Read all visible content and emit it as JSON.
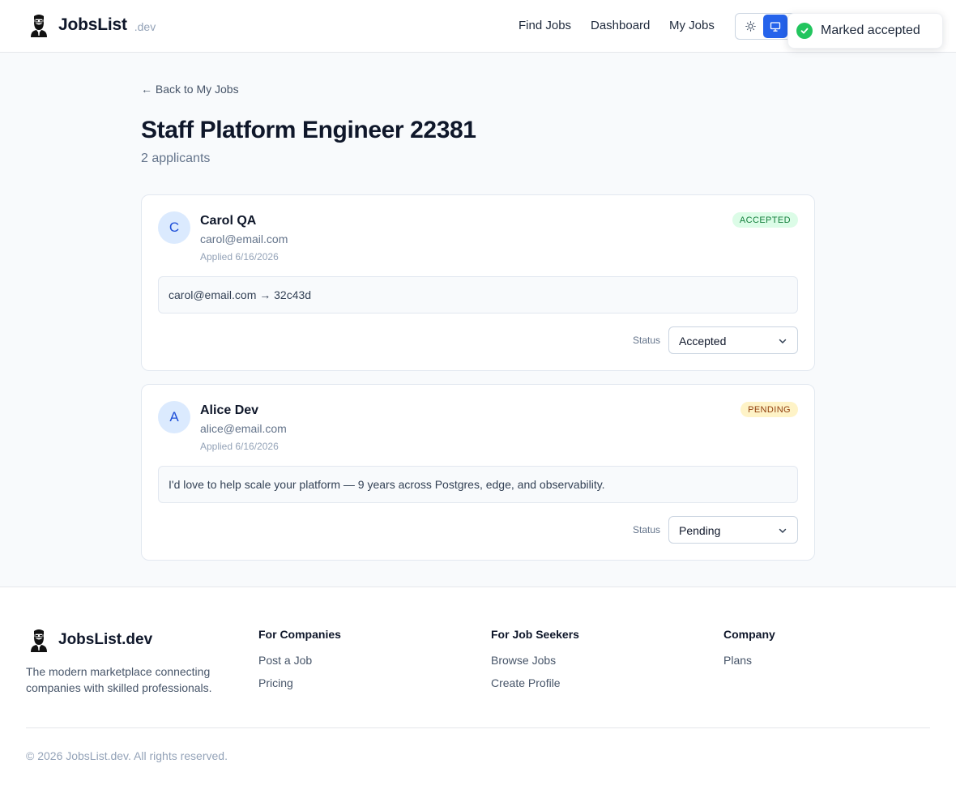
{
  "header": {
    "logo_text": "JobsList",
    "logo_suffix": ".dev",
    "logo_icon": "bearded-man-icon",
    "nav": [
      "Find Jobs",
      "Dashboard",
      "My Jobs"
    ],
    "theme_icons": [
      "sun-icon",
      "monitor-icon"
    ],
    "accent": "#2563eb"
  },
  "toast": {
    "text": "Marked accepted",
    "icon": "check-circle-icon",
    "color": "#22c55e"
  },
  "page": {
    "back_link": "← Back to My Jobs",
    "title": "Staff Platform Engineer 22381",
    "subtitle": "2 applicants"
  },
  "applicants": [
    {
      "initial": "C",
      "name": "Carol QA",
      "email": "carol@email.com",
      "applied": "Applied 6/16/2026",
      "badge": "ACCEPTED",
      "badge_color": "#15803d",
      "message": "carol@email.com → 32c43d",
      "status_label": "Status",
      "status_value": "Accepted"
    },
    {
      "initial": "A",
      "name": "Alice Dev",
      "email": "alice@email.com",
      "applied": "Applied 6/16/2026",
      "badge": "PENDING",
      "badge_color": "#92400e",
      "message": "I'd love to help scale your platform — 9 years across Postgres, edge, and observability.",
      "status_label": "Status",
      "status_value": "Pending"
    }
  ],
  "footer": {
    "logo_text": "JobsList.dev",
    "description": "The modern marketplace connecting companies with skilled professionals.",
    "columns": [
      {
        "heading": "For Companies",
        "links": [
          "Post a Job",
          "Pricing"
        ]
      },
      {
        "heading": "For Job Seekers",
        "links": [
          "Browse Jobs",
          "Create Profile"
        ]
      },
      {
        "heading": "Company",
        "links": [
          "Plans"
        ]
      }
    ],
    "copyright": "© 2026 JobsList.dev. All rights reserved."
  }
}
